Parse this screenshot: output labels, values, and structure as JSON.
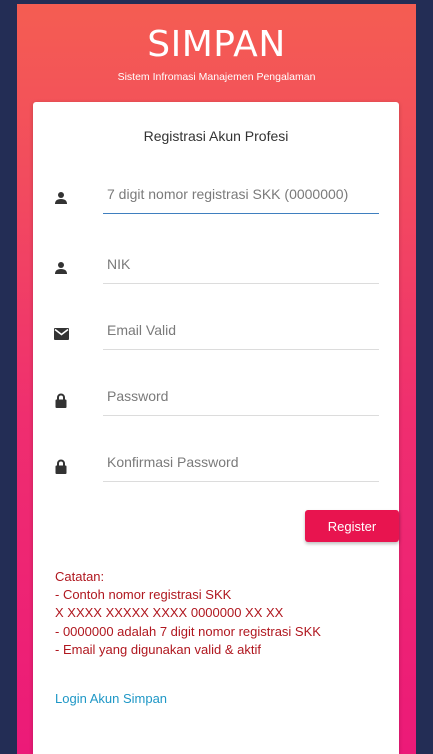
{
  "brand": {
    "title": "SIMPAN",
    "subtitle": "Sistem Infromasi Manajemen Pengalaman"
  },
  "form": {
    "title": "Registrasi Akun Profesi",
    "fields": [
      {
        "placeholder": "7 digit nomor registrasi SKK (0000000)",
        "icon": "user-icon"
      },
      {
        "placeholder": "NIK",
        "icon": "user-icon"
      },
      {
        "placeholder": "Email Valid",
        "icon": "envelope-icon"
      },
      {
        "placeholder": "Password",
        "icon": "lock-icon"
      },
      {
        "placeholder": "Konfirmasi Password",
        "icon": "lock-icon"
      }
    ],
    "register_label": "Register"
  },
  "notes": {
    "header": "Catatan:",
    "lines": [
      "- Contoh nomor registrasi SKK",
      "X XXXX XXXXX XXXX 0000000 XX XX",
      "- 0000000 adalah 7 digit nomor registrasi SKK",
      "- Email yang digunakan valid & aktif"
    ]
  },
  "login_link": "Login Akun Simpan",
  "colors": {
    "background": "#232d55",
    "gradient_top": "#f45d52",
    "gradient_bottom": "#ec1a78",
    "button": "#e8144f",
    "notes_text": "#b0171f",
    "link": "#1e97c6",
    "active_underline": "#3f7fbf"
  }
}
